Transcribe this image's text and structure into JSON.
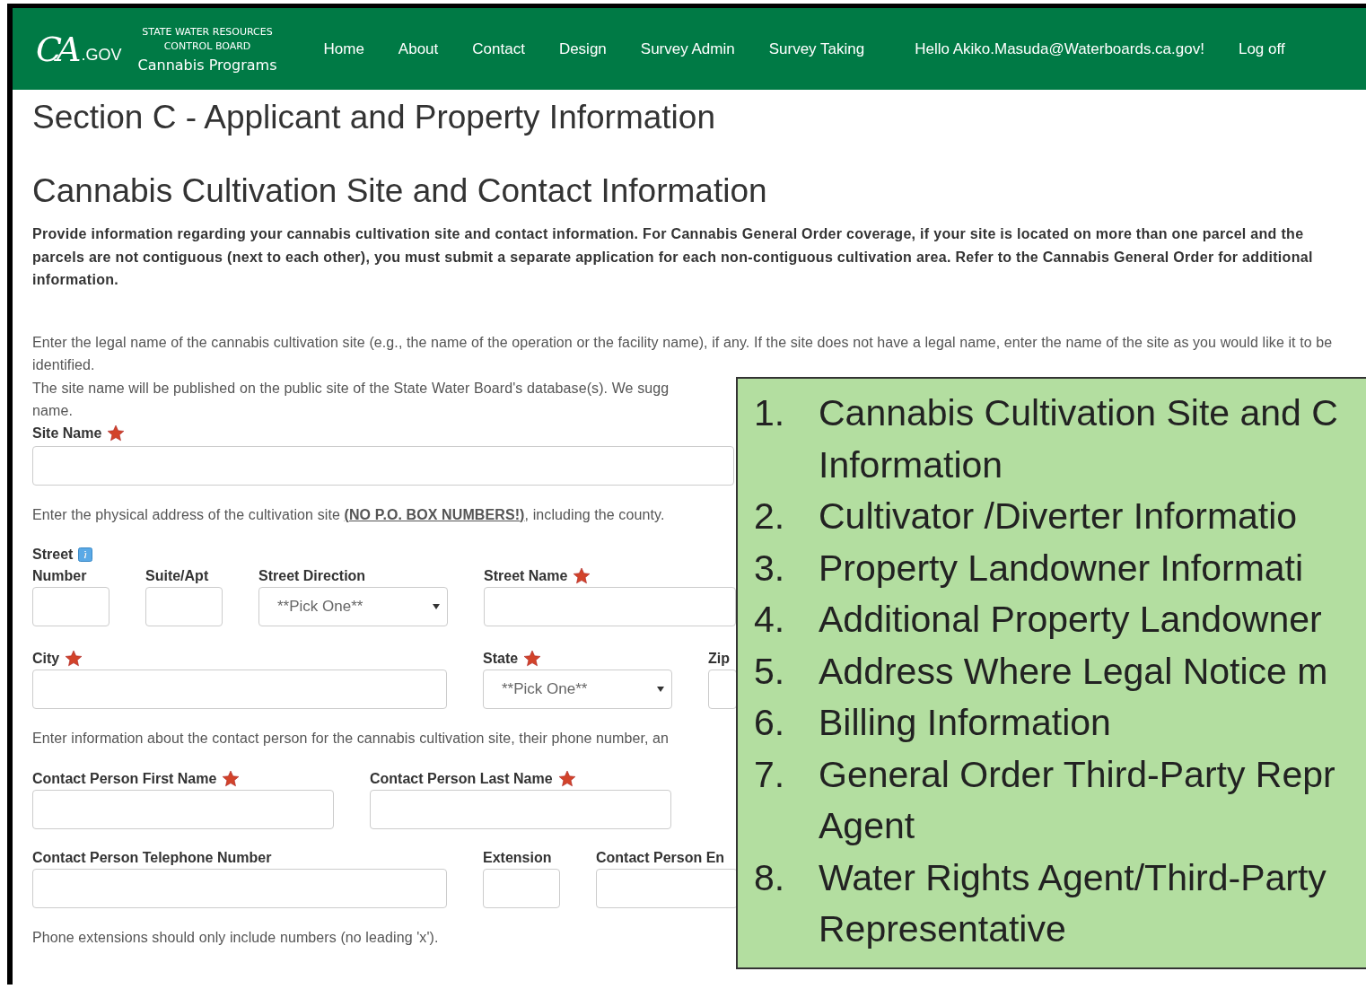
{
  "header": {
    "logo": {
      "mark": "CA",
      "suffix": ".GOV"
    },
    "agency": [
      "STATE WATER RESOURCES",
      "CONTROL BOARD"
    ],
    "program": "Cannabis Programs",
    "nav": [
      {
        "label": "Home"
      },
      {
        "label": "About"
      },
      {
        "label": "Contact"
      },
      {
        "label": "Design"
      },
      {
        "label": "Survey Admin"
      },
      {
        "label": "Survey Taking"
      }
    ],
    "greeting": "Hello Akiko.Masuda@Waterboards.ca.gov!",
    "logoff": "Log off"
  },
  "section_title": "Section C - Applicant and Property Information",
  "subsection_title": "Cannabis Cultivation Site and Contact Information",
  "intro": "Provide information regarding your cannabis cultivation site and contact information. For Cannabis General Order coverage, if your site is located on more than one parcel and the parcels are not contiguous (next to each other), you must submit a separate application for each non-contiguous cultivation area. Refer to the Cannabis General Order for additional information.",
  "site_help": [
    "Enter the legal name of the cannabis cultivation site (e.g., the name of the operation or the facility name), if any. If the site does not have a legal name, enter the name of the site as you would like it to be identified.",
    "The site name will be published on the public site of the State Water Board's database(s). We sugg",
    "name."
  ],
  "site_name": {
    "label": "Site Name",
    "required": true
  },
  "address_help": "Enter the physical address of the cultivation site **(NO P.O. BOX NUMBERS!)**, including the county.",
  "address_rows": [
    [
      {
        "label": "Street",
        "label2": "Number",
        "info": true,
        "required": false,
        "kind": "input"
      },
      {
        "label": "Suite/Apt",
        "required": false,
        "kind": "input"
      },
      {
        "label": "Street Direction",
        "required": false,
        "kind": "select",
        "placeholder": "**Pick One**"
      },
      {
        "label": "Street Name",
        "required": true,
        "kind": "input"
      }
    ],
    [
      {
        "label": "City",
        "required": true,
        "kind": "input"
      },
      {
        "label": "State",
        "required": true,
        "kind": "select",
        "placeholder": "**Pick One**"
      },
      {
        "label": "Zip",
        "required": false,
        "kind": "input"
      }
    ]
  ],
  "contact_help": "Enter information about the contact person for the cannabis cultivation site, their phone number, an",
  "contact_rows": [
    [
      {
        "label": "Contact Person First Name",
        "required": true,
        "kind": "input"
      },
      {
        "label": "Contact Person Last Name",
        "required": true,
        "kind": "input"
      }
    ],
    [
      {
        "label": "Contact Person Telephone Number",
        "required": false,
        "kind": "input"
      },
      {
        "label": "Extension",
        "required": false,
        "kind": "input"
      },
      {
        "label": "Contact Person En",
        "required": false,
        "kind": "input"
      }
    ]
  ],
  "phone_note": "Phone extensions should only include numbers (no leading 'x').",
  "callout": [
    {
      "number": "1.",
      "lines": [
        "Cannabis Cultivation Site and C",
        "Information"
      ]
    },
    {
      "number": "2.",
      "lines": [
        "Cultivator /Diverter Informatio"
      ]
    },
    {
      "number": "3.",
      "lines": [
        "Property Landowner Informati"
      ]
    },
    {
      "number": "4.",
      "lines": [
        "Additional Property Landowner"
      ]
    },
    {
      "number": "5.",
      "lines": [
        "Address Where Legal Notice m"
      ]
    },
    {
      "number": "6.",
      "lines": [
        "Billing Information"
      ]
    },
    {
      "number": "7.",
      "lines": [
        "General Order Third-Party Repr",
        "Agent"
      ]
    },
    {
      "number": "8.",
      "lines": [
        "Water Rights Agent/Third-Party",
        "Representative"
      ]
    }
  ]
}
